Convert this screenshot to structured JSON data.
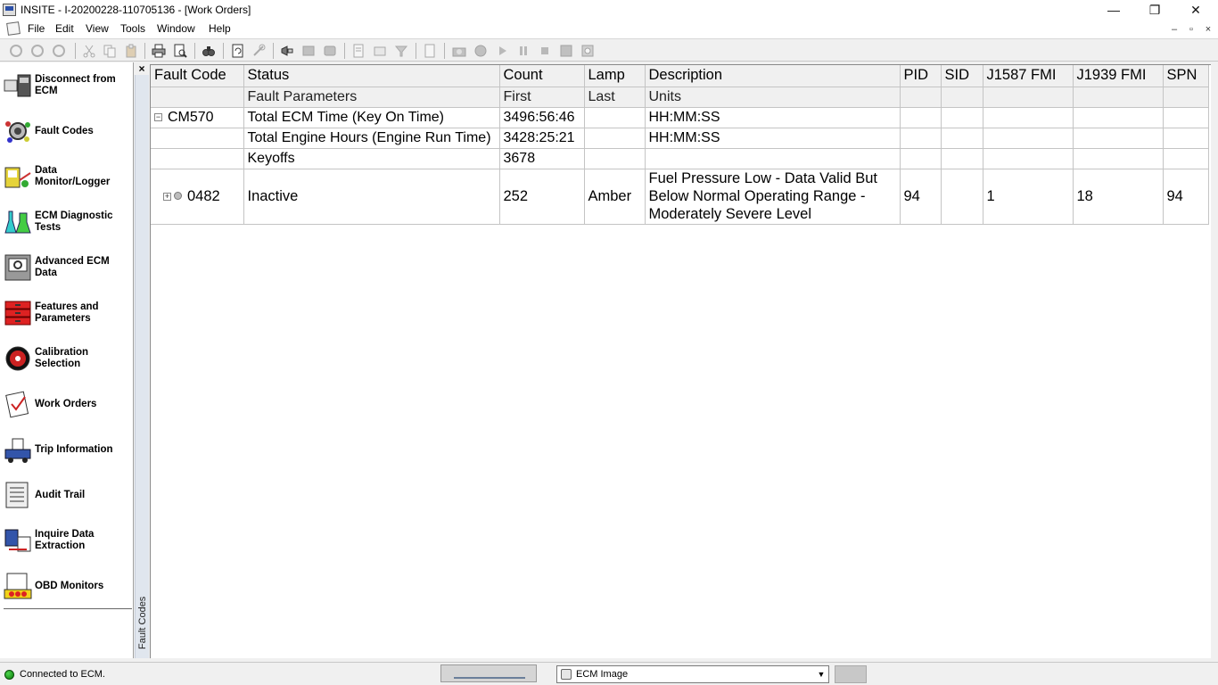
{
  "window": {
    "title": "INSITE - I-20200228-110705136 - [Work Orders]",
    "minimize": "—",
    "restore": "❐",
    "close": "✕",
    "mdi_minimize": "–",
    "mdi_restore": "▫",
    "mdi_close": "×"
  },
  "menu": [
    "File",
    "Edit",
    "View",
    "Tools",
    "Window",
    "Help"
  ],
  "sidebar": {
    "close": "×",
    "items": [
      {
        "label": "Disconnect from ECM",
        "icon": "disconnect-icon"
      },
      {
        "label": "Fault Codes",
        "icon": "fault-codes-icon"
      },
      {
        "label": "Data Monitor/Logger",
        "icon": "data-monitor-icon"
      },
      {
        "label": "ECM Diagnostic Tests",
        "icon": "diagnostic-tests-icon"
      },
      {
        "label": "Advanced ECM Data",
        "icon": "advanced-ecm-icon"
      },
      {
        "label": "Features and Parameters",
        "icon": "features-icon"
      },
      {
        "label": "Calibration Selection",
        "icon": "calibration-icon"
      },
      {
        "label": "Work Orders",
        "icon": "work-orders-icon"
      },
      {
        "label": "Trip Information",
        "icon": "trip-icon"
      },
      {
        "label": "Audit Trail",
        "icon": "audit-trail-icon"
      },
      {
        "label": "Inquire Data Extraction",
        "icon": "inquire-icon"
      },
      {
        "label": "OBD Monitors",
        "icon": "obd-icon"
      }
    ]
  },
  "vertical_tab": "Fault Codes",
  "grid": {
    "header1": [
      "Fault Code",
      "Status",
      "Count",
      "Lamp",
      "Description",
      "PID",
      "SID",
      "J1587 FMI",
      "J1939 FMI",
      "SPN"
    ],
    "header2": [
      "",
      "Fault Parameters",
      "First",
      "Last",
      "Units",
      "",
      "",
      "",
      "",
      ""
    ],
    "group": {
      "expander": "−",
      "code": "CM570",
      "rows": [
        {
          "param": "Total ECM Time (Key On Time)",
          "first": "3496:56:46",
          "last": "",
          "units": "HH:MM:SS"
        },
        {
          "param": "Total Engine Hours (Engine Run Time)",
          "first": "3428:25:21",
          "last": "",
          "units": "HH:MM:SS"
        },
        {
          "param": "Keyoffs",
          "first": "3678",
          "last": "",
          "units": ""
        }
      ]
    },
    "fault": {
      "expander": "+",
      "code": "0482",
      "status": "Inactive",
      "count": "252",
      "lamp": "Amber",
      "description": "Fuel Pressure Low - Data Valid But Below Normal Operating Range - Moderately Severe Level",
      "pid": "94",
      "sid": "",
      "j1587_fmi": "1",
      "j1939_fmi": "18",
      "spn": "94"
    }
  },
  "status": {
    "text": "Connected to ECM.",
    "led_color": "#22aa22",
    "image_select": "ECM Image"
  }
}
